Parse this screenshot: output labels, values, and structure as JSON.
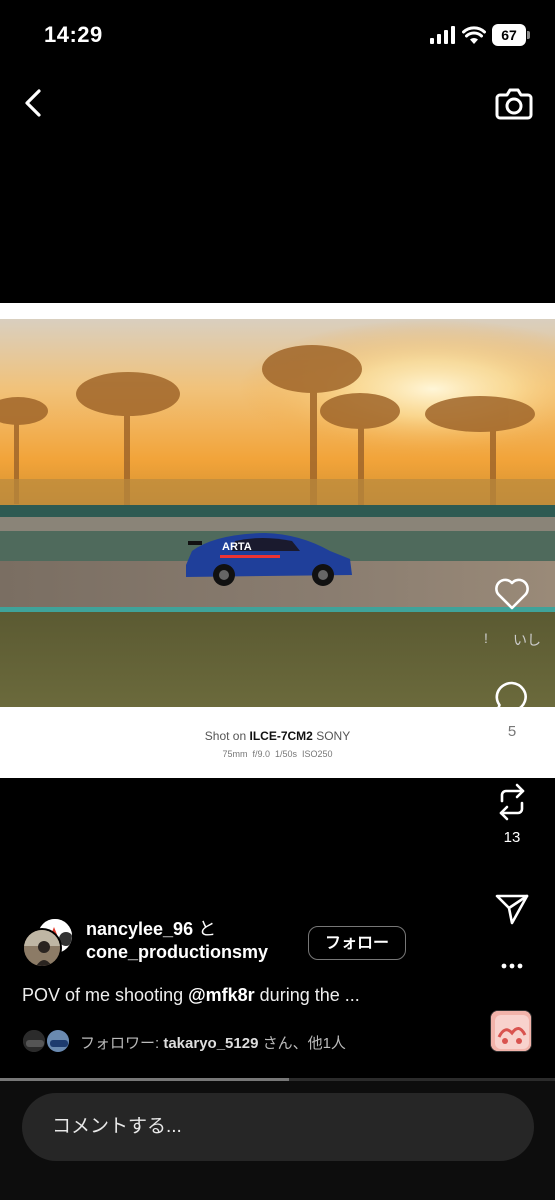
{
  "status_bar": {
    "time": "14:29",
    "battery": "67"
  },
  "post": {
    "exif": {
      "shot_on_prefix": "Shot on",
      "model": "ILCE-7CM2",
      "brand": "SONY",
      "settings": "75mm  f/9.0  1/50s  ISO250"
    },
    "car_livery_text": "ARTA"
  },
  "actions": {
    "like_sub_left": "!",
    "like_sub_right": "いし",
    "comment_count": "5",
    "repost_count": "13"
  },
  "author": {
    "name1": "nancylee_96",
    "joiner": "と",
    "name2": "cone_productionsmy",
    "follow_label": "フォロー"
  },
  "caption": {
    "prefix": "POV of me shooting ",
    "mention": "@mfk8r",
    "suffix": " during the ..."
  },
  "followers": {
    "prefix": "フォロワー: ",
    "user": "takaryo_5129",
    "suffix": " さん、他1人"
  },
  "video_progress": 0.52,
  "comment": {
    "placeholder": "コメントする..."
  },
  "colors": {
    "background": "#000000",
    "sunset_orange": "#f0a53a",
    "car_blue": "#1f3f9a"
  }
}
